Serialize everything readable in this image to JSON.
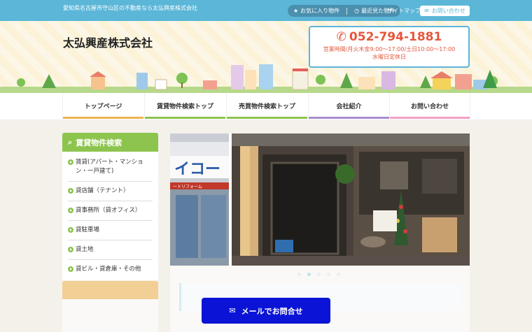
{
  "topbar": {
    "tagline": "愛知県名古屋市守山区の不動産なら太弘興産株式会社",
    "favorites": "お気に入り物件",
    "recent": "最近見た物件",
    "sitemap": "サイトマップ",
    "contact": "お問い合わせ"
  },
  "header": {
    "company": "太弘興産株式会社",
    "phone": "052-794-1881",
    "hours1": "営業時間/月火木金9:00～17:00/土日10:00～17:00",
    "hours2": "水曜日定休日"
  },
  "nav": {
    "items": [
      {
        "label": "トップページ",
        "color": "#f0b24e"
      },
      {
        "label": "賃貸物件検索トップ",
        "color": "#8dc44e"
      },
      {
        "label": "売買物件検索トップ",
        "color": "#8dc44e"
      },
      {
        "label": "会社紹介",
        "color": "#a88fd0"
      },
      {
        "label": "お問い合わせ",
        "color": "#f2a0c8"
      }
    ]
  },
  "sidebar": {
    "title": "賃貸物件検索",
    "items": [
      "賃貸(アパート・マンション・一戸建て)",
      "貸店舗（テナント）",
      "貸事務所（貸オフィス）",
      "貸駐車場",
      "貸土地",
      "貸ビル・貸倉庫・その他"
    ]
  },
  "slider": {
    "sign_text": "イコー",
    "sign_text2": "ートリフォーム",
    "dot_count": 5,
    "active_dot": 1
  },
  "mail_button": "メールでお問合せ",
  "colors": {
    "accent_blue": "#5bb6d8",
    "green": "#8dc44e",
    "phone_red": "#e4573c",
    "mail_blue": "#0b14d6"
  }
}
